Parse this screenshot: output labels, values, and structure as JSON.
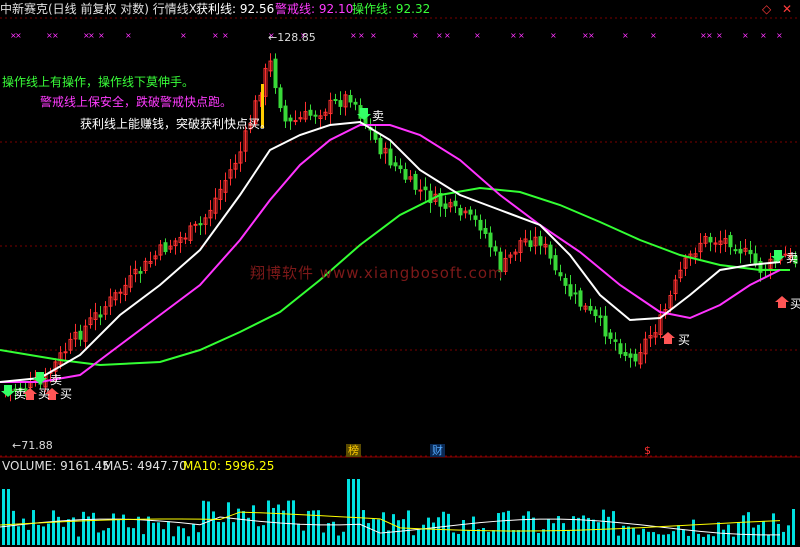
{
  "header": {
    "title": "中新赛克(日线 前复权 对数) 行情线X",
    "items": [
      {
        "label": "获利线",
        "value": "92.56",
        "color": "#ffffff"
      },
      {
        "label": "警戒线",
        "value": "92.10",
        "color": "#ff3bff"
      },
      {
        "label": "操作线",
        "value": "92.32",
        "color": "#39ff39"
      }
    ]
  },
  "window_controls": {
    "left": "◇",
    "right": "✕"
  },
  "annotations": {
    "line1": "操作线上有操作，操作线下莫伸手。",
    "line2": "警戒线上保安全，跌破警戒快点跑。",
    "line3": "获利线上能赚钱，突破获利快点买。"
  },
  "price_labels": {
    "high": "128.85",
    "low": "71.88"
  },
  "signals": {
    "buy": "买",
    "sell": "卖"
  },
  "watermark": "翔博软件 www.xiangbosoft.com",
  "event_tags": [
    {
      "text": "榜",
      "color": "#ffcc00"
    },
    {
      "text": "财",
      "color": "#55aaff"
    },
    {
      "text": "$",
      "color": "#ff3030"
    }
  ],
  "volume": {
    "volume_label": "VOLUME:",
    "volume_value": "9161.45",
    "ma5_label": "MA5:",
    "ma5_value": "4947.70",
    "ma10_label": "MA10:",
    "ma10_value": "5996.25",
    "ma5_color": "#ffffff",
    "ma10_color": "#ffff00"
  },
  "colors": {
    "up": "#ff3030",
    "down": "#39d939",
    "volume": "#00e0e0",
    "profit_line": "#ffffff",
    "warning_line": "#ff33ff",
    "operation_line": "#33ff33",
    "x_marker": "#ff33ff",
    "grid": "#7a0000"
  },
  "signal_colors": {
    "buy": "#ff5555",
    "sell": "#33ff66"
  }
}
